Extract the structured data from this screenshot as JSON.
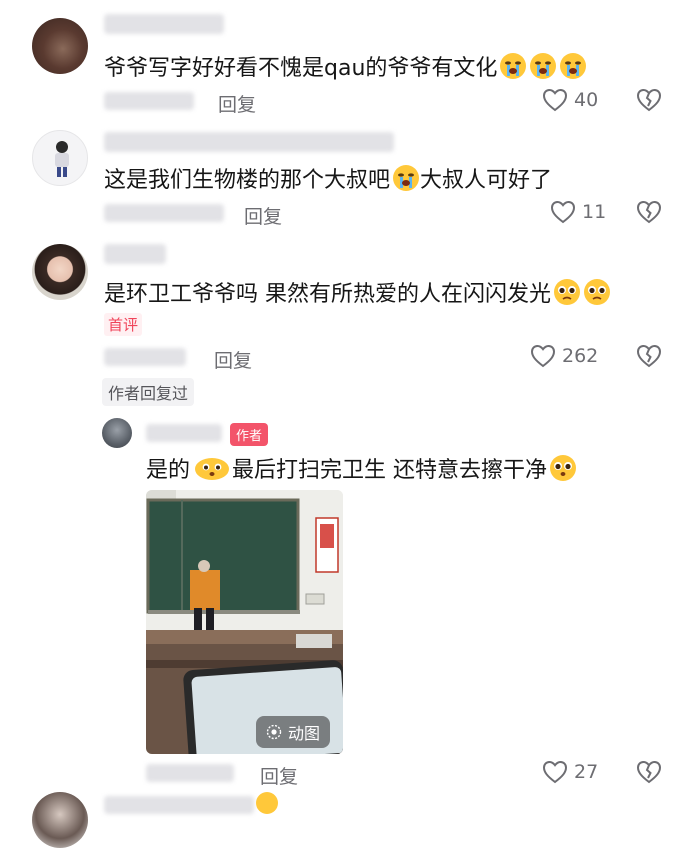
{
  "comments": [
    {
      "text": "爷爷写字好好看不愧是qau的爷爷有文化",
      "emoji": [
        "crying-face-icon",
        "crying-face-icon",
        "crying-face-icon"
      ],
      "reply_label": "回复",
      "likes": "40"
    },
    {
      "text_before": "这是我们生物楼的那个大叔吧",
      "text_after": "大叔人可好了",
      "reply_label": "回复",
      "likes": "11"
    },
    {
      "text": "是环卫工爷爷吗 果然有所热爱的人在闪闪发光",
      "emoji": [
        "pleading-face-icon",
        "pleading-face-icon"
      ],
      "pinned_label": "首评",
      "reply_label": "回复",
      "likes": "262",
      "author_replied_label": "作者回复过"
    }
  ],
  "author_reply": {
    "badge": "作者",
    "text_before": "是的",
    "text_middle": "最后打扫完卫生 还特意去擦干净",
    "gif_label": "动图",
    "reply_label": "回复",
    "likes": "27"
  },
  "colors": {
    "accent_pink": "#f3546a",
    "secondary_text": "#6d6d72",
    "emoji_yellow": "#ffc83a"
  }
}
